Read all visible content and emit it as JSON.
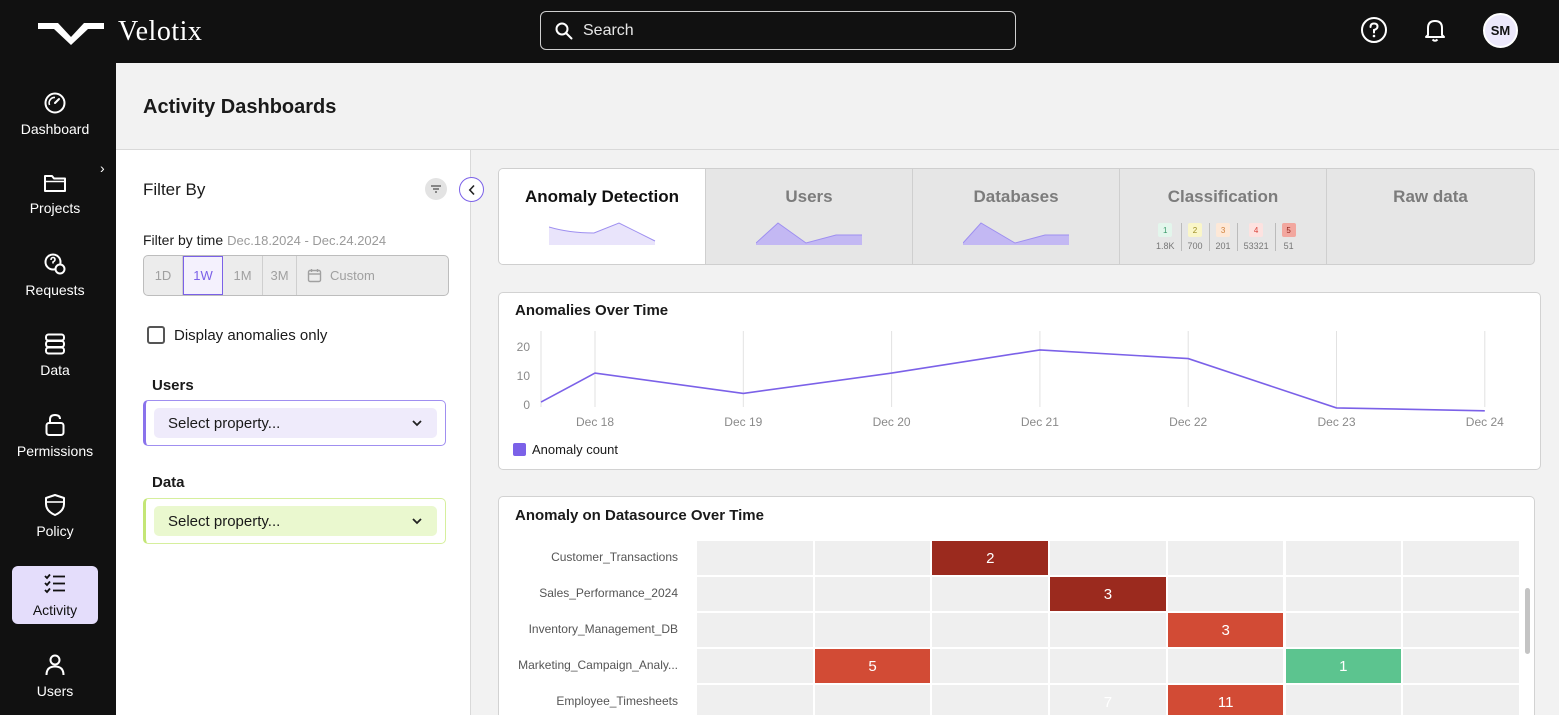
{
  "app": {
    "name": "Velotix"
  },
  "search": {
    "placeholder": "Search"
  },
  "user": {
    "initials": "SM"
  },
  "nav": {
    "items": [
      {
        "label": "Dashboard",
        "icon": "gauge-icon"
      },
      {
        "label": "Projects",
        "icon": "folder-icon"
      },
      {
        "label": "Requests",
        "icon": "request-icon"
      },
      {
        "label": "Data",
        "icon": "database-icon"
      },
      {
        "label": "Permissions",
        "icon": "lock-icon"
      },
      {
        "label": "Policy",
        "icon": "shield-icon"
      },
      {
        "label": "Activity",
        "icon": "checklist-icon"
      },
      {
        "label": "Users",
        "icon": "user-icon"
      }
    ],
    "active": "Activity"
  },
  "page": {
    "title": "Activity Dashboards"
  },
  "filter": {
    "title": "Filter By",
    "time_label": "Filter by time",
    "time_range": "Dec.18.2024 - Dec.24.2024",
    "time_options": [
      "1D",
      "1W",
      "1M",
      "3M"
    ],
    "time_custom": "Custom",
    "time_selected": "1W",
    "anomalies_only_label": "Display anomalies only",
    "anomalies_only_checked": false,
    "users_label": "Users",
    "users_select": "Select property...",
    "data_label": "Data",
    "data_select": "Select property..."
  },
  "tabs": {
    "items": [
      {
        "label": "Anomaly Detection"
      },
      {
        "label": "Users"
      },
      {
        "label": "Databases"
      },
      {
        "label": "Classification"
      },
      {
        "label": "Raw data"
      }
    ],
    "active": "Anomaly Detection",
    "classification": [
      {
        "level": "1",
        "count": "1.8K",
        "bg": "#e3f6ec",
        "fg": "#3a9b6a"
      },
      {
        "level": "2",
        "count": "700",
        "bg": "#faf6c8",
        "fg": "#9b8b20"
      },
      {
        "level": "3",
        "count": "201",
        "bg": "#fde8d7",
        "fg": "#d0803b"
      },
      {
        "level": "4",
        "count": "53321",
        "bg": "#fde2e0",
        "fg": "#d9433a"
      },
      {
        "level": "5",
        "count": "51",
        "bg": "#f2a79f",
        "fg": "#8f1f18"
      }
    ]
  },
  "colors": {
    "accent": "#7b61e8",
    "heat_dark": "#9b2a1e",
    "heat_mid": "#d24b35",
    "heat_green": "#5cc48f",
    "users_select_bg": "#efebfb",
    "data_select_bg": "#eaf8cf"
  },
  "chart_data": [
    {
      "type": "line",
      "title": "Anomalies Over Time",
      "x": [
        "Dec 18",
        "Dec 19",
        "Dec 20",
        "Dec 21",
        "Dec 22",
        "Dec 23",
        "Dec 24"
      ],
      "series": [
        {
          "name": "Anomaly count",
          "x": [
            "Dec 17",
            "Dec 18",
            "Dec 19",
            "Dec 20",
            "Dec 21",
            "Dec 22",
            "Dec 23",
            "Dec 24"
          ],
          "values": [
            1,
            11,
            4,
            11,
            19,
            16,
            -1,
            -2
          ]
        }
      ],
      "yticks": [
        0,
        10,
        20
      ],
      "ylim": [
        -3,
        22
      ],
      "grid": "vertical",
      "legend": "bottom-left"
    },
    {
      "type": "heatmap",
      "title": "Anomaly on Datasource Over Time",
      "rows": [
        "Customer_Transactions",
        "Sales_Performance_2024",
        "Inventory_Management_DB",
        "Marketing_Campaign_Analy...",
        "Employee_Timesheets"
      ],
      "columns": 7,
      "cells": [
        {
          "row": 0,
          "col": 2,
          "value": "2",
          "level": "dark"
        },
        {
          "row": 1,
          "col": 3,
          "value": "3",
          "level": "dark"
        },
        {
          "row": 2,
          "col": 4,
          "value": "3",
          "level": "mid"
        },
        {
          "row": 3,
          "col": 1,
          "value": "5",
          "level": "mid"
        },
        {
          "row": 3,
          "col": 5,
          "value": "1",
          "level": "green"
        },
        {
          "row": 4,
          "col": 3,
          "value": "7",
          "level": "none"
        },
        {
          "row": 4,
          "col": 4,
          "value": "11",
          "level": "mid"
        }
      ]
    }
  ]
}
